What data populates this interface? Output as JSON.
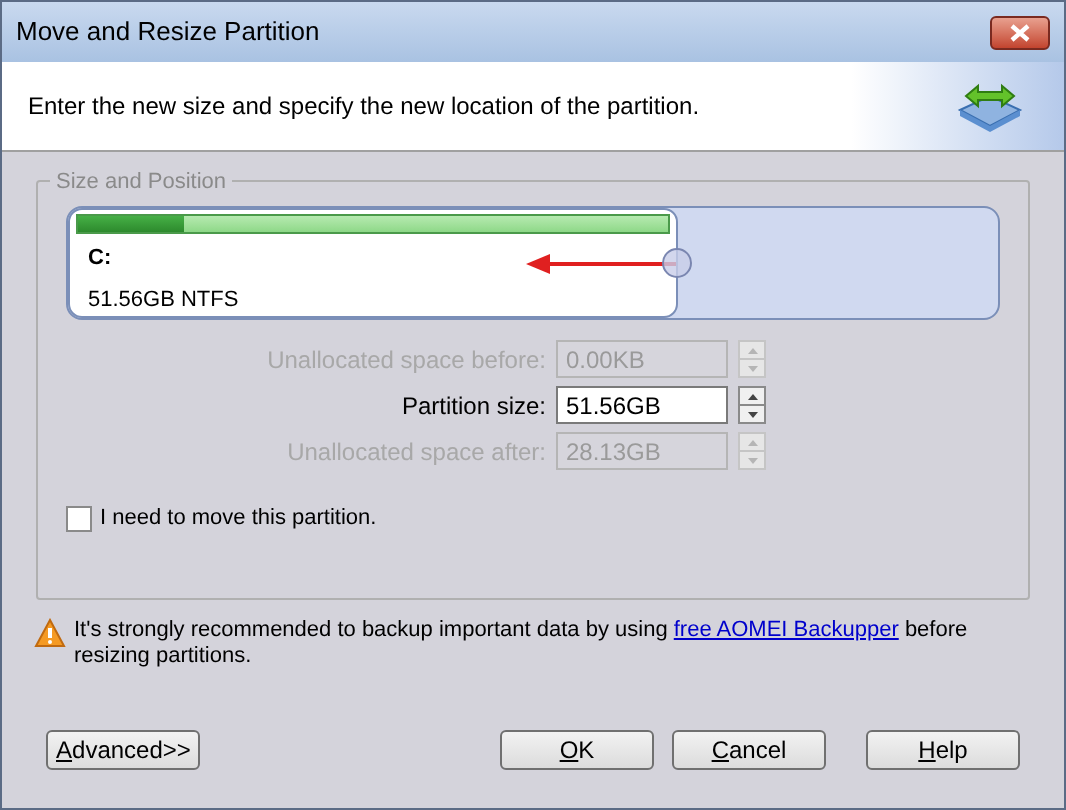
{
  "window": {
    "title": "Move and Resize Partition"
  },
  "header": {
    "instruction": "Enter the new size and specify the new location of the partition."
  },
  "group": {
    "title": "Size and Position"
  },
  "partition": {
    "drive": "C:",
    "info": "51.56GB NTFS",
    "level": 0.18
  },
  "fields": [
    {
      "label": "Unallocated space before:",
      "value": "0.00KB",
      "disabled": true
    },
    {
      "label": "Partition size:",
      "value": "51.56GB",
      "disabled": false
    },
    {
      "label": "Unallocated space after:",
      "value": "28.13GB",
      "disabled": true
    }
  ],
  "move_checkbox": {
    "label": "I need to move this partition.",
    "checked": false
  },
  "warning": {
    "before": "It's strongly recommended to backup important data by using",
    "link": "free AOMEI Backupper",
    "after": "before resizing partitions."
  },
  "buttons": [
    {
      "label": "Advanced>>",
      "kind": "left"
    },
    {
      "label": "OK",
      "kind": "right"
    },
    {
      "label": "Cancel",
      "kind": "right"
    },
    {
      "label": "Help",
      "kind": "right"
    }
  ]
}
